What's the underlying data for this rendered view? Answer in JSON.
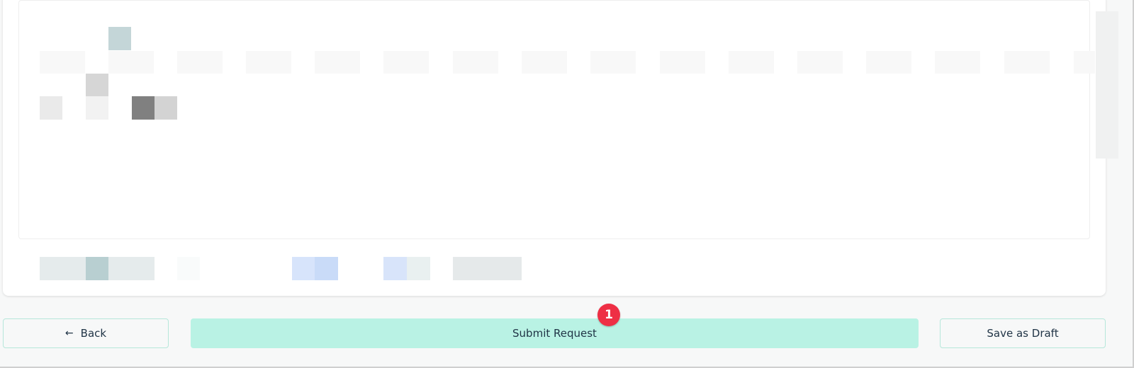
{
  "footer": {
    "back_label": "Back",
    "back_icon": "arrow-left-icon",
    "submit_label": "Submit Request",
    "draft_label": "Save as Draft"
  },
  "annotation": {
    "marker_label": "1"
  },
  "colors": {
    "submit_bg": "#b9f2e4",
    "button_border": "#b6e7da",
    "marker_bg": "#ee2f45",
    "page_bg": "#f7f8f8"
  }
}
